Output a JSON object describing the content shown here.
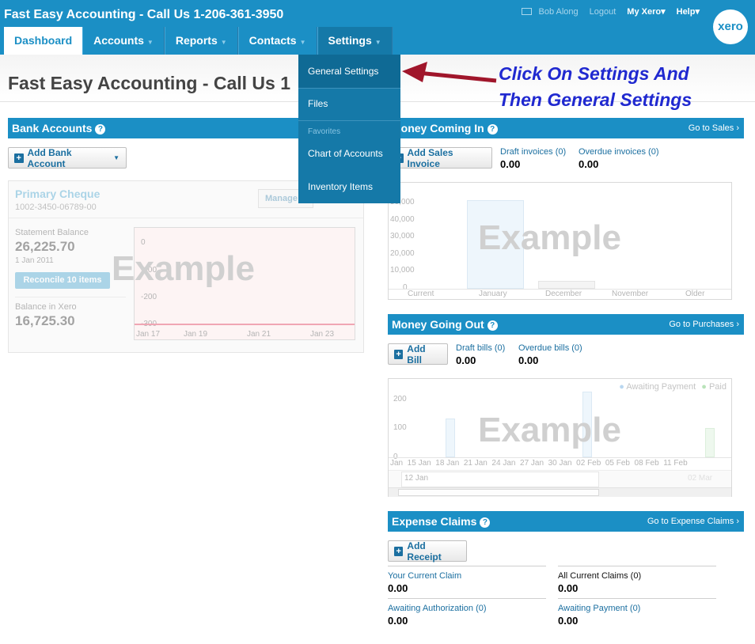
{
  "header": {
    "org_title": "Fast Easy Accounting - Call Us 1-206-361-3950",
    "user_name": "Bob Along",
    "logout": "Logout",
    "my_xero": "My Xero",
    "help": "Help",
    "logo_text": "xero"
  },
  "nav": {
    "tabs": [
      {
        "label": "Dashboard"
      },
      {
        "label": "Accounts"
      },
      {
        "label": "Reports"
      },
      {
        "label": "Contacts"
      },
      {
        "label": "Settings"
      }
    ]
  },
  "page": {
    "title": "Fast Easy Accounting - Call Us 1"
  },
  "settings_menu": {
    "general": "General Settings",
    "files": "Files",
    "favorites_heading": "Favorites",
    "chart_of_accounts": "Chart of Accounts",
    "inventory_items": "Inventory Items"
  },
  "annotation": {
    "line1": "Click On Settings And",
    "line2": "Then General Settings"
  },
  "bank": {
    "heading": "Bank Accounts",
    "add_button": "Add Bank Account",
    "account_name": "Primary Cheque",
    "account_number": "1002-3450-06789-00",
    "manage_button": "Manage",
    "statement_label": "Statement Balance",
    "statement_value": "26,225.70",
    "statement_date": "1 Jan 2011",
    "reconcile_button": "Reconcile 10 items",
    "xero_label": "Balance in Xero",
    "xero_value": "16,725.30",
    "watermark": "Example",
    "y_ticks": [
      "0",
      "-100",
      "-200",
      "-300"
    ],
    "x_ticks": [
      "Jan 17",
      "Jan 19",
      "Jan 21",
      "Jan 23"
    ]
  },
  "money_in": {
    "heading": "Money Coming In",
    "link": "Go to Sales",
    "add_button": "Add Sales Invoice",
    "draft_label": "Draft invoices (0)",
    "draft_value": "0.00",
    "overdue_label": "Overdue invoices (0)",
    "overdue_value": "0.00",
    "watermark": "Example",
    "y_ticks": [
      "50,000",
      "40,000",
      "30,000",
      "20,000",
      "10,000",
      "0"
    ],
    "x_ticks": [
      "Current",
      "January",
      "December",
      "November",
      "Older"
    ]
  },
  "money_out": {
    "heading": "Money Going Out",
    "link": "Go to Purchases",
    "add_button": "Add Bill",
    "draft_label": "Draft bills (0)",
    "draft_value": "0.00",
    "overdue_label": "Overdue bills (0)",
    "overdue_value": "0.00",
    "watermark": "Example",
    "legend_awaiting": "Awaiting Payment",
    "legend_paid": "Paid",
    "y_ticks": [
      "200",
      "100",
      "0"
    ],
    "x_ticks": "Jan  15 Jan  18 Jan  21 Jan  24 Jan  27 Jan  30 Jan  02 Feb  05 Feb  08 Feb  11 Feb",
    "nav_start": "12 Jan",
    "nav_end": "02 Mar"
  },
  "expense": {
    "heading": "Expense Claims",
    "link": "Go to Expense Claims",
    "add_button": "Add Receipt",
    "current_label": "Your Current Claim",
    "current_value": "0.00",
    "all_label": "All Current Claims (0)",
    "all_value": "0.00",
    "auth_label": "Awaiting Authorization (0)",
    "auth_value": "0.00",
    "payment_label": "Awaiting Payment (0)",
    "payment_value": "0.00"
  },
  "colors": {
    "brand_blue": "#1b8fc5",
    "menu_blue": "#1579a8",
    "annotation_blue": "#2029d0",
    "arrow_red": "#a0162b"
  }
}
